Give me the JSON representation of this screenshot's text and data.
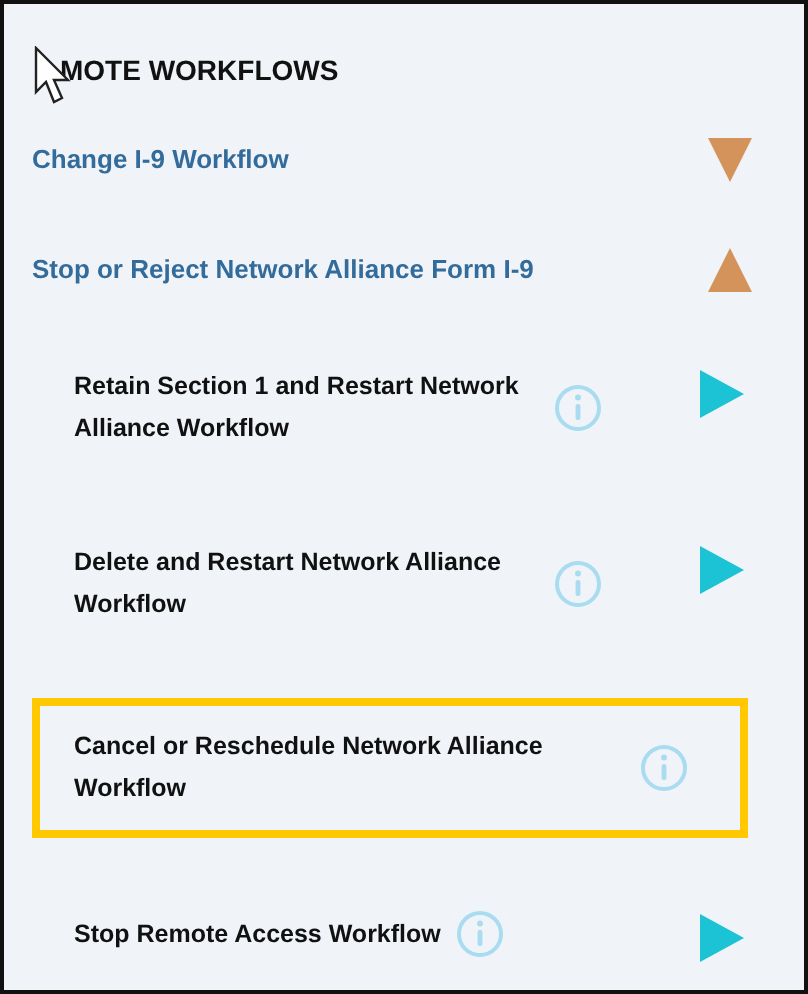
{
  "heading": "MOTE WORKFLOWS",
  "groups": [
    {
      "label": "Change I-9 Workflow",
      "expanded": false
    },
    {
      "label": "Stop or Reject Network Alliance Form I-9",
      "expanded": true,
      "children": [
        {
          "label": "Retain Section 1 and Restart Network Alliance Workflow",
          "highlighted": false
        },
        {
          "label": "Delete and Restart Network Alliance Workflow",
          "highlighted": false
        },
        {
          "label": "Cancel or Reschedule Network Alliance Workflow",
          "highlighted": true
        }
      ]
    }
  ],
  "items": [
    {
      "label": "Stop Remote Access Workflow",
      "highlighted": false
    }
  ]
}
